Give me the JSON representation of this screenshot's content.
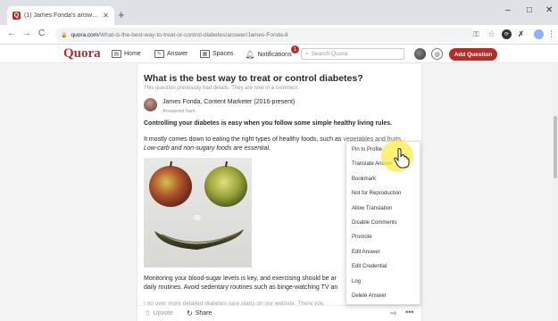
{
  "browser": {
    "tab_title": "(1) James Fonda's answer to Wh...",
    "tab_favicon": "Q",
    "new_tab": "+",
    "url_host": "quora.com",
    "url_path": "/What-is-the-best-way-to-treat-or-control-diabetes/answer/James-Fonda-8",
    "back": "←",
    "forward": "→",
    "reload": "C",
    "minimize": "–",
    "maximize": "□",
    "close": "✕"
  },
  "quora_header": {
    "logo": "Quora",
    "nav": {
      "home": "Home",
      "answer": "Answer",
      "spaces": "Spaces",
      "notifications": "Notifications"
    },
    "notification_count": "1",
    "search_placeholder": "Search Quora",
    "add_question": "Add Question"
  },
  "question": {
    "title": "What is the best way to treat or control diabetes?",
    "subtitle": "This question previously had details. They are now in a comment."
  },
  "answer": {
    "author": "James Fonda, Content Marketer (2016-present)",
    "answered": "Answered 5am",
    "lead": "Controlling your diabetes is easy when you follow some simple healthy living rules.",
    "para1_start": "It mostly comes down to eating the right types of healthy foods, such as ",
    "para1_highlight": "vegetables and fruits.",
    "para1_italic": "Low-carb and non-sugary foods are essential.",
    "para2_line1": "Monitoring your blood-sugar levels is key, and exercising should be ar",
    "para2_line2": "daily routines. Avoid sedentary routines such as binge-watching TV an",
    "para3": "I go over more detailed diabetes care plans on our website. There you"
  },
  "actions": {
    "upvote": "Upvote",
    "share": "Share"
  },
  "menu": {
    "items": [
      "Pin to Profile",
      "Translate Answer",
      "Bookmark",
      "Not for Reproduction",
      "Allow Translation",
      "Disable Comments",
      "Promote",
      "Edit Answer",
      "Edit Credential",
      "Log",
      "Delete Answer"
    ]
  },
  "colors": {
    "brand": "#b92b27",
    "chrome_bg": "#dee1e6",
    "highlight": "#ffec46"
  }
}
